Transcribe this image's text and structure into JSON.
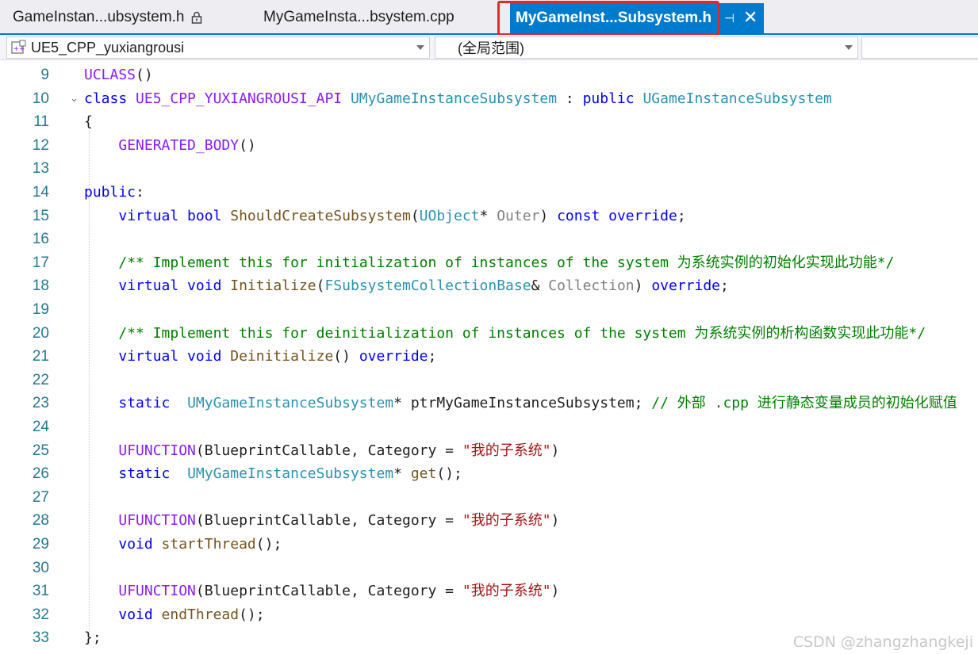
{
  "tabs": [
    {
      "label": "GameInstan...ubsystem.h",
      "locked": true,
      "active": false
    },
    {
      "label": "MyGameInsta...bsystem.cpp",
      "locked": false,
      "active": false
    },
    {
      "label": "MyGameInst...Subsystem.h",
      "locked": false,
      "active": true
    }
  ],
  "tab_controls": {
    "pin_icon": "pin-icon",
    "close_icon": "close-icon",
    "pin_glyph": "⊣",
    "close_glyph": "✕"
  },
  "navbar": {
    "project": "UE5_CPP_yuxiangrousi",
    "scope": "(全局范围)",
    "third": ""
  },
  "colors": {
    "accent": "#007acc",
    "highlight_box": "#e8262a",
    "keyword": "#0000ff",
    "macro": "#8a1bff",
    "type": "#2b91af",
    "function": "#74531f",
    "comment": "#008000",
    "string": "#a31515",
    "line_number": "#237893"
  },
  "editor": {
    "lines": [
      {
        "n": "9",
        "tokens": [
          [
            "mac",
            "UCLASS"
          ],
          [
            "p",
            "()"
          ]
        ]
      },
      {
        "n": "10",
        "fold": "⌄",
        "tokens": [
          [
            "kw",
            "class "
          ],
          [
            "mac",
            "UE5_CPP_YUXIANGROUSI_API "
          ],
          [
            "typ",
            "UMyGameInstanceSubsystem"
          ],
          [
            "p",
            " : "
          ],
          [
            "kw",
            "public "
          ],
          [
            "typ",
            "UGameInstanceSubsystem"
          ]
        ]
      },
      {
        "n": "11",
        "tokens": [
          [
            "p",
            "{"
          ]
        ]
      },
      {
        "n": "12",
        "tokens": [
          [
            "p",
            "    "
          ],
          [
            "mac",
            "GENERATED_BODY"
          ],
          [
            "p",
            "()"
          ]
        ]
      },
      {
        "n": "13",
        "tokens": []
      },
      {
        "n": "14",
        "tokens": [
          [
            "kw",
            "public"
          ],
          [
            "p",
            ":"
          ]
        ]
      },
      {
        "n": "15",
        "tokens": [
          [
            "p",
            "    "
          ],
          [
            "kw",
            "virtual bool "
          ],
          [
            "fn",
            "ShouldCreateSubsystem"
          ],
          [
            "p",
            "("
          ],
          [
            "typ",
            "UObject"
          ],
          [
            "p",
            "* "
          ],
          [
            "prm",
            "Outer"
          ],
          [
            "p",
            ") "
          ],
          [
            "kw",
            "const override"
          ],
          [
            "p",
            ";"
          ]
        ]
      },
      {
        "n": "16",
        "tokens": []
      },
      {
        "n": "17",
        "tokens": [
          [
            "p",
            "    "
          ],
          [
            "cm",
            "/** Implement this for initialization of instances of the system 为系统实例的初始化实现此功能*/"
          ]
        ]
      },
      {
        "n": "18",
        "tokens": [
          [
            "p",
            "    "
          ],
          [
            "kw",
            "virtual void "
          ],
          [
            "fn",
            "Initialize"
          ],
          [
            "p",
            "("
          ],
          [
            "typ",
            "FSubsystemCollectionBase"
          ],
          [
            "p",
            "& "
          ],
          [
            "prm",
            "Collection"
          ],
          [
            "p",
            ") "
          ],
          [
            "kw",
            "override"
          ],
          [
            "p",
            ";"
          ]
        ]
      },
      {
        "n": "19",
        "tokens": []
      },
      {
        "n": "20",
        "tokens": [
          [
            "p",
            "    "
          ],
          [
            "cm",
            "/** Implement this for deinitialization of instances of the system 为系统实例的析构函数实现此功能*/"
          ]
        ]
      },
      {
        "n": "21",
        "tokens": [
          [
            "p",
            "    "
          ],
          [
            "kw",
            "virtual void "
          ],
          [
            "fn",
            "Deinitialize"
          ],
          [
            "p",
            "() "
          ],
          [
            "kw",
            "override"
          ],
          [
            "p",
            ";"
          ]
        ]
      },
      {
        "n": "22",
        "tokens": []
      },
      {
        "n": "23",
        "tokens": [
          [
            "p",
            "    "
          ],
          [
            "kw",
            "static  "
          ],
          [
            "typ",
            "UMyGameInstanceSubsystem"
          ],
          [
            "p",
            "* ptrMyGameInstanceSubsystem; "
          ],
          [
            "cm",
            "// 外部 .cpp 进行静态变量成员的初始化赋值"
          ]
        ]
      },
      {
        "n": "24",
        "tokens": []
      },
      {
        "n": "25",
        "tokens": [
          [
            "p",
            "    "
          ],
          [
            "mac",
            "UFUNCTION"
          ],
          [
            "p",
            "(BlueprintCallable, Category = "
          ],
          [
            "str",
            "\"我的子系统\""
          ],
          [
            "p",
            ")"
          ]
        ]
      },
      {
        "n": "26",
        "tokens": [
          [
            "p",
            "    "
          ],
          [
            "kw",
            "static  "
          ],
          [
            "typ",
            "UMyGameInstanceSubsystem"
          ],
          [
            "p",
            "* "
          ],
          [
            "fn",
            "get"
          ],
          [
            "p",
            "();"
          ]
        ]
      },
      {
        "n": "27",
        "tokens": []
      },
      {
        "n": "28",
        "tokens": [
          [
            "p",
            "    "
          ],
          [
            "mac",
            "UFUNCTION"
          ],
          [
            "p",
            "(BlueprintCallable, Category = "
          ],
          [
            "str",
            "\"我的子系统\""
          ],
          [
            "p",
            ")"
          ]
        ]
      },
      {
        "n": "29",
        "tokens": [
          [
            "p",
            "    "
          ],
          [
            "kw",
            "void "
          ],
          [
            "fn",
            "startThread"
          ],
          [
            "p",
            "();"
          ]
        ]
      },
      {
        "n": "30",
        "tokens": []
      },
      {
        "n": "31",
        "tokens": [
          [
            "p",
            "    "
          ],
          [
            "mac",
            "UFUNCTION"
          ],
          [
            "p",
            "(BlueprintCallable, Category = "
          ],
          [
            "str",
            "\"我的子系统\""
          ],
          [
            "p",
            ")"
          ]
        ]
      },
      {
        "n": "32",
        "tokens": [
          [
            "p",
            "    "
          ],
          [
            "kw",
            "void "
          ],
          [
            "fn",
            "endThread"
          ],
          [
            "p",
            "();"
          ]
        ]
      },
      {
        "n": "33",
        "tokens": [
          [
            "p",
            "};"
          ]
        ]
      }
    ]
  },
  "watermark": "CSDN @zhangzhangkeji"
}
